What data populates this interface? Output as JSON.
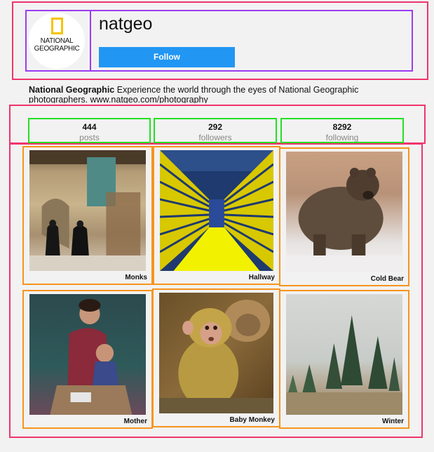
{
  "profile": {
    "username": "natgeo",
    "logo_text": "NATIONAL GEOGRAPHIC",
    "follow_label": "Follow",
    "bio_name": "National Geographic",
    "bio_text": "Experience the world through the eyes of National Geographic photographers. www.natgeo.com/photography"
  },
  "stats": [
    {
      "value": "444",
      "label": "posts"
    },
    {
      "value": "292",
      "label": "followers"
    },
    {
      "value": "8292",
      "label": "following"
    }
  ],
  "photos": [
    {
      "caption": "Monks"
    },
    {
      "caption": "Hallway"
    },
    {
      "caption": "Cold Bear"
    },
    {
      "caption": "Mother"
    },
    {
      "caption": "Baby Monkey"
    },
    {
      "caption": "Winter"
    }
  ],
  "colors": {
    "follow_button": "#2196f3",
    "logo_yellow": "#f5c400",
    "annotation_pink": "#f0346c",
    "annotation_purple": "#9b3cf0",
    "annotation_green": "#22e022",
    "annotation_orange": "#f7941d"
  }
}
